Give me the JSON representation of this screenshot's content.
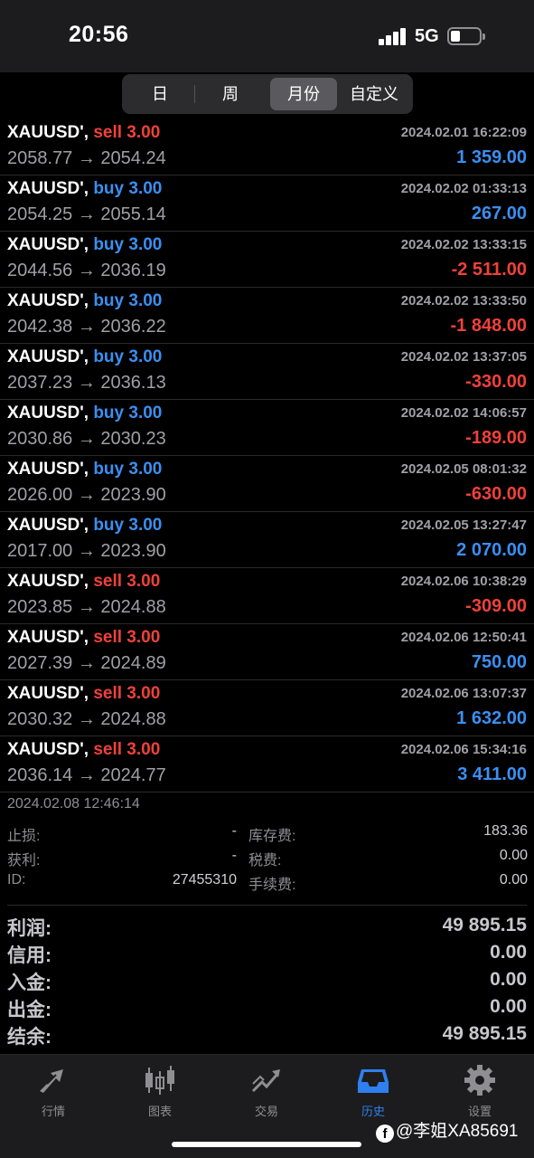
{
  "status_bar": {
    "time": "20:56",
    "network": "5G"
  },
  "period_tabs": [
    {
      "label": "日",
      "active": false
    },
    {
      "label": "周",
      "active": false
    },
    {
      "label": "月份",
      "active": true
    },
    {
      "label": "自定义",
      "active": false
    }
  ],
  "colors": {
    "buy": "#3b8ff2",
    "sell": "#f0413a",
    "profit_positive": "#3b8ff2",
    "profit_negative": "#f0413a",
    "accent": "#2f7ff0"
  },
  "trades": [
    {
      "symbol": "XAUUSD',",
      "side": "sell",
      "volume": "3.00",
      "datetime": "2024.02.01 16:22:09",
      "open_price": "2058.77",
      "close_price": "2054.24",
      "profit": "1 359.00",
      "profit_sign": "positive"
    },
    {
      "symbol": "XAUUSD',",
      "side": "buy",
      "volume": "3.00",
      "datetime": "2024.02.02 01:33:13",
      "open_price": "2054.25",
      "close_price": "2055.14",
      "profit": "267.00",
      "profit_sign": "positive"
    },
    {
      "symbol": "XAUUSD',",
      "side": "buy",
      "volume": "3.00",
      "datetime": "2024.02.02 13:33:15",
      "open_price": "2044.56",
      "close_price": "2036.19",
      "profit": "-2 511.00",
      "profit_sign": "negative"
    },
    {
      "symbol": "XAUUSD',",
      "side": "buy",
      "volume": "3.00",
      "datetime": "2024.02.02 13:33:50",
      "open_price": "2042.38",
      "close_price": "2036.22",
      "profit": "-1 848.00",
      "profit_sign": "negative"
    },
    {
      "symbol": "XAUUSD',",
      "side": "buy",
      "volume": "3.00",
      "datetime": "2024.02.02 13:37:05",
      "open_price": "2037.23",
      "close_price": "2036.13",
      "profit": "-330.00",
      "profit_sign": "negative"
    },
    {
      "symbol": "XAUUSD',",
      "side": "buy",
      "volume": "3.00",
      "datetime": "2024.02.02 14:06:57",
      "open_price": "2030.86",
      "close_price": "2030.23",
      "profit": "-189.00",
      "profit_sign": "negative"
    },
    {
      "symbol": "XAUUSD',",
      "side": "buy",
      "volume": "3.00",
      "datetime": "2024.02.05 08:01:32",
      "open_price": "2026.00",
      "close_price": "2023.90",
      "profit": "-630.00",
      "profit_sign": "negative"
    },
    {
      "symbol": "XAUUSD',",
      "side": "buy",
      "volume": "3.00",
      "datetime": "2024.02.05 13:27:47",
      "open_price": "2017.00",
      "close_price": "2023.90",
      "profit": "2 070.00",
      "profit_sign": "positive"
    },
    {
      "symbol": "XAUUSD',",
      "side": "sell",
      "volume": "3.00",
      "datetime": "2024.02.06 10:38:29",
      "open_price": "2023.85",
      "close_price": "2024.88",
      "profit": "-309.00",
      "profit_sign": "negative"
    },
    {
      "symbol": "XAUUSD',",
      "side": "sell",
      "volume": "3.00",
      "datetime": "2024.02.06 12:50:41",
      "open_price": "2027.39",
      "close_price": "2024.89",
      "profit": "750.00",
      "profit_sign": "positive"
    },
    {
      "symbol": "XAUUSD',",
      "side": "sell",
      "volume": "3.00",
      "datetime": "2024.02.06 13:07:37",
      "open_price": "2030.32",
      "close_price": "2024.88",
      "profit": "1 632.00",
      "profit_sign": "positive"
    },
    {
      "symbol": "XAUUSD',",
      "side": "sell",
      "volume": "3.00",
      "datetime": "2024.02.06 15:34:16",
      "open_price": "2036.14",
      "close_price": "2024.77",
      "profit": "3 411.00",
      "profit_sign": "positive"
    }
  ],
  "arrow": "→",
  "detail": {
    "timestamp": "2024.02.08 12:46:14",
    "stop_loss_label": "止损:",
    "stop_loss_value": "-",
    "take_profit_label": "获利:",
    "take_profit_value": "-",
    "id_label": "ID:",
    "id_value": "27455310",
    "swap_label": "库存费:",
    "swap_value": "183.36",
    "tax_label": "税费:",
    "tax_value": "0.00",
    "fee_label": "手续费:",
    "fee_value": "0.00"
  },
  "summary": [
    {
      "label": "利润:",
      "value": "49 895.15"
    },
    {
      "label": "信用:",
      "value": "0.00"
    },
    {
      "label": "入金:",
      "value": "0.00"
    },
    {
      "label": "出金:",
      "value": "0.00"
    },
    {
      "label": "结余:",
      "value": "49 895.15"
    }
  ],
  "tabbar": [
    {
      "label": "行情",
      "icon": "quotes-arrows-icon",
      "active": false
    },
    {
      "label": "图表",
      "icon": "candlestick-chart-icon",
      "active": false
    },
    {
      "label": "交易",
      "icon": "trade-chart-icon",
      "active": false
    },
    {
      "label": "历史",
      "icon": "history-inbox-icon",
      "active": true
    },
    {
      "label": "设置",
      "icon": "gear-icon",
      "active": false
    }
  ],
  "watermark": {
    "icon": "facebook-icon",
    "text": "@李姐XA85691"
  }
}
